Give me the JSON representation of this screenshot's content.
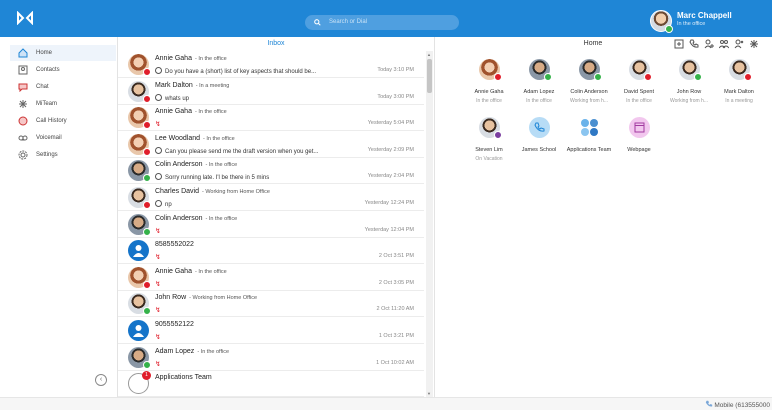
{
  "header": {
    "search_placeholder": "Search or Dial",
    "user_name": "Marc Chappell",
    "user_status": "In the office"
  },
  "sidebar": {
    "items": [
      {
        "label": "Home",
        "icon": "home-icon",
        "active": true
      },
      {
        "label": "Contacts",
        "icon": "contacts-icon"
      },
      {
        "label": "Chat",
        "icon": "chat-icon"
      },
      {
        "label": "MiTeam",
        "icon": "miteam-icon"
      },
      {
        "label": "Call History",
        "icon": "call-history-icon"
      },
      {
        "label": "Voicemail",
        "icon": "voicemail-icon"
      },
      {
        "label": "Settings",
        "icon": "settings-icon"
      }
    ],
    "collapse": "‹"
  },
  "inbox": {
    "title": "Inbox",
    "rows": [
      {
        "name": "Annie Gaha",
        "status": "- In the office",
        "msg": "Do you have a (short) list of key aspects that should be...",
        "time": "Today 3:10 PM",
        "type": "chat",
        "avatar": "face-f",
        "presence": "red"
      },
      {
        "name": "Mark Dalton",
        "status": "- In a meeting",
        "msg": "whats up",
        "time": "Today 3:00 PM",
        "type": "chat",
        "avatar": "face-m",
        "presence": "red"
      },
      {
        "name": "Annie Gaha",
        "status": "- In the office",
        "msg": "",
        "time": "Yesterday 5:04 PM",
        "type": "missed",
        "avatar": "face-f",
        "presence": "red"
      },
      {
        "name": "Lee Woodland",
        "status": "- In the office",
        "msg": "Can you please send me the draft version when you get...",
        "time": "Yesterday 2:09 PM",
        "type": "chat",
        "avatar": "face-f",
        "presence": "red"
      },
      {
        "name": "Colin Anderson",
        "status": "- In the office",
        "msg": "Sorry running late. I'l be there in 5 mins",
        "time": "Yesterday 2:04 PM",
        "type": "chat",
        "avatar": "face-m2",
        "presence": "green"
      },
      {
        "name": "Charles David",
        "status": "- Working from Home Office",
        "msg": "np",
        "time": "Yesterday 12:24 PM",
        "type": "chat",
        "avatar": "face-m",
        "presence": "red"
      },
      {
        "name": "Colin Anderson",
        "status": "- In the office",
        "msg": "",
        "time": "Yesterday 12:04 PM",
        "type": "missed",
        "avatar": "face-m2",
        "presence": "green"
      },
      {
        "name": "8585552022",
        "status": "",
        "msg": "",
        "time": "2 Oct 3:51 PM",
        "type": "missed",
        "avatar": "num",
        "presence": ""
      },
      {
        "name": "Annie Gaha",
        "status": "- In the office",
        "msg": "",
        "time": "2 Oct 3:05 PM",
        "type": "missed",
        "avatar": "face-f",
        "presence": "red"
      },
      {
        "name": "John Row",
        "status": "- Working from Home Office",
        "msg": "",
        "time": "2 Oct 11:20 AM",
        "type": "missed",
        "avatar": "face-m",
        "presence": "green"
      },
      {
        "name": "9055552122",
        "status": "",
        "msg": "",
        "time": "1 Oct 3:21 PM",
        "type": "missed",
        "avatar": "num",
        "presence": ""
      },
      {
        "name": "Adam Lopez",
        "status": "- In the office",
        "msg": "",
        "time": "1 Oct 10:02 AM",
        "type": "missed",
        "avatar": "face-m2",
        "presence": "green"
      },
      {
        "name": "Applications Team",
        "status": "",
        "msg": "",
        "time": "",
        "type": "team",
        "avatar": "team",
        "presence": "",
        "badge": "1"
      }
    ]
  },
  "home": {
    "title": "Home",
    "tiles": [
      {
        "name": "Annie Gaha",
        "sub": "In the office",
        "avatar": "face-f",
        "presence": "red"
      },
      {
        "name": "Adam Lopez",
        "sub": "In the office",
        "avatar": "face-m2",
        "presence": "green"
      },
      {
        "name": "Colin Anderson",
        "sub": "Working from h...",
        "avatar": "face-m2",
        "presence": "green"
      },
      {
        "name": "David Spent",
        "sub": "In the office",
        "avatar": "face-m",
        "presence": "red"
      },
      {
        "name": "John Row",
        "sub": "Working from h...",
        "avatar": "face-m",
        "presence": "green"
      },
      {
        "name": "Mark Dalton",
        "sub": "In a meeting",
        "avatar": "face-m",
        "presence": "red"
      },
      {
        "name": "Steven Lim",
        "sub": "On Vacation",
        "avatar": "face-m",
        "presence": "purple"
      },
      {
        "name": "James School",
        "sub": "",
        "avatar": "phone",
        "presence": ""
      },
      {
        "name": "Applications Team",
        "sub": "",
        "avatar": "apps",
        "presence": ""
      },
      {
        "name": "Webpage",
        "sub": "",
        "avatar": "web",
        "presence": ""
      }
    ]
  },
  "footer": {
    "mobile": "Mobile (613555000"
  },
  "colors": {
    "brand": "#1f86d6",
    "presence_red": "#e01e2b",
    "presence_green": "#35b24a",
    "missed_call": "#e01e2b"
  }
}
